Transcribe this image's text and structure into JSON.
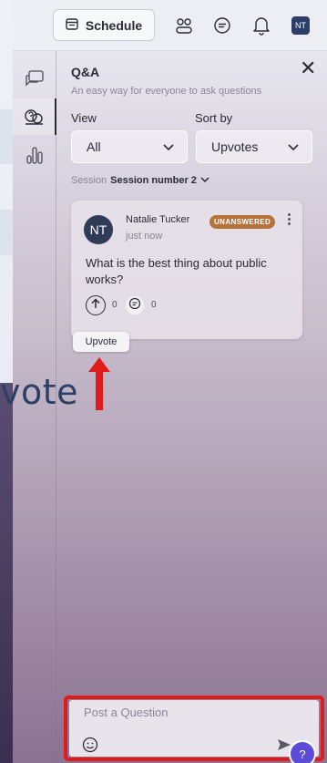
{
  "header": {
    "schedule_label": "Schedule",
    "avatar_initials": "NT"
  },
  "rail": {
    "items": [
      "chat",
      "qa",
      "polls"
    ],
    "active": "qa"
  },
  "qa": {
    "title": "Q&A",
    "subtitle": "An easy way for everyone to ask questions",
    "view_label": "View",
    "view_value": "All",
    "sort_label": "Sort by",
    "sort_value": "Upvotes",
    "session_label": "Session",
    "session_value": "Session number 2"
  },
  "question_card": {
    "avatar_initials": "NT",
    "author": "Natalie Tucker",
    "time": "just now",
    "status": "UNANSWERED",
    "text": "What is the best thing about public works?",
    "upvotes": "0",
    "comments": "0"
  },
  "tooltip": {
    "label": "Upvote"
  },
  "background": {
    "partial_text": "vote"
  },
  "compose": {
    "placeholder": "Post a Question"
  },
  "colors": {
    "badge": "#b5723a",
    "highlight": "#e21a1a",
    "help": "#5b4bd7",
    "avatar": "#2f3b57"
  }
}
